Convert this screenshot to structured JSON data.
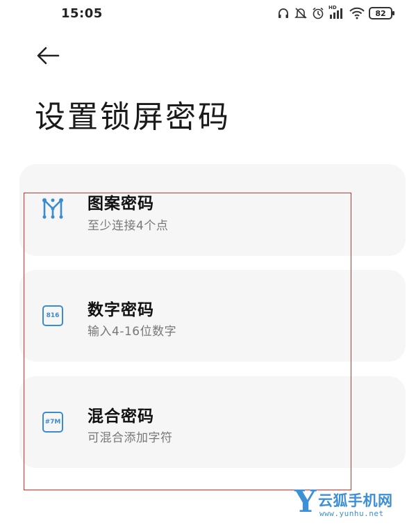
{
  "status_bar": {
    "time": "15:05",
    "hd_label": "HD",
    "battery_level": "82",
    "icons": [
      "headphones-icon",
      "mute-icon",
      "alarm-icon",
      "hd-signal-icon",
      "wifi-icon",
      "battery-icon"
    ]
  },
  "header": {
    "back_icon": "back-arrow-icon",
    "title": "设置锁屏密码"
  },
  "options": [
    {
      "title": "图案密码",
      "subtitle": "至少连接4个点",
      "icon": "pattern-icon"
    },
    {
      "title": "数字密码",
      "subtitle": "输入4-16位数字",
      "icon": "numeric-icon",
      "icon_text": "816"
    },
    {
      "title": "混合密码",
      "subtitle": "可混合添加字符",
      "icon": "mixed-icon",
      "icon_text": "#7M"
    }
  ],
  "colors": {
    "accent": "#3a8bd0",
    "highlight": "#d9302c",
    "card_bg": "#f6f6f6"
  },
  "watermark": {
    "logo_letter": "Y",
    "name": "云狐手机网",
    "url": "www.yunhu.net"
  }
}
